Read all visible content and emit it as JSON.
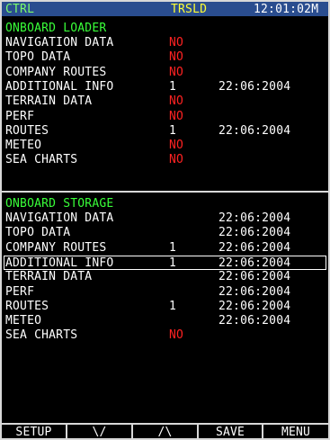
{
  "header": {
    "mode": "CTRL",
    "status": "TRSLD",
    "time": "12:01:02M"
  },
  "onboard_loader": {
    "title": "ONBOARD LOADER",
    "rows": [
      {
        "name": "NAVIGATION DATA",
        "value": "NO",
        "date": ""
      },
      {
        "name": "TOPO DATA",
        "value": "NO",
        "date": ""
      },
      {
        "name": "COMPANY ROUTES",
        "value": "NO",
        "date": ""
      },
      {
        "name": "ADDITIONAL INFO",
        "value": "1",
        "date": "22:06:2004"
      },
      {
        "name": "TERRAIN DATA",
        "value": "NO",
        "date": ""
      },
      {
        "name": "PERF",
        "value": "NO",
        "date": ""
      },
      {
        "name": "ROUTES",
        "value": "1",
        "date": "22:06:2004"
      },
      {
        "name": "METEO",
        "value": "NO",
        "date": ""
      },
      {
        "name": "SEA CHARTS",
        "value": "NO",
        "date": ""
      }
    ]
  },
  "onboard_storage": {
    "title": "ONBOARD STORAGE",
    "rows": [
      {
        "name": "NAVIGATION DATA",
        "value": "",
        "date": "22:06:2004"
      },
      {
        "name": "TOPO DATA",
        "value": "",
        "date": "22:06:2004"
      },
      {
        "name": "COMPANY ROUTES",
        "value": "1",
        "date": "22:06:2004"
      },
      {
        "name": "ADDITIONAL INFO",
        "value": "1",
        "date": "22:06:2004"
      },
      {
        "name": "TERRAIN DATA",
        "value": "",
        "date": "22:06:2004"
      },
      {
        "name": "PERF",
        "value": "",
        "date": "22:06:2004"
      },
      {
        "name": "ROUTES",
        "value": "1",
        "date": "22:06:2004"
      },
      {
        "name": "METEO",
        "value": "",
        "date": "22:06:2004"
      },
      {
        "name": "SEA CHARTS",
        "value": "NO",
        "date": ""
      }
    ],
    "selected_row": "ADDITIONAL INFO"
  },
  "softkeys": [
    "SETUP",
    "\\/",
    "/\\",
    "SAVE",
    "MENU"
  ],
  "colors": {
    "header_bg": "#2a4d8f",
    "section_title": "#39ff39",
    "no_value": "#ff2222",
    "status": "#ffff33"
  }
}
